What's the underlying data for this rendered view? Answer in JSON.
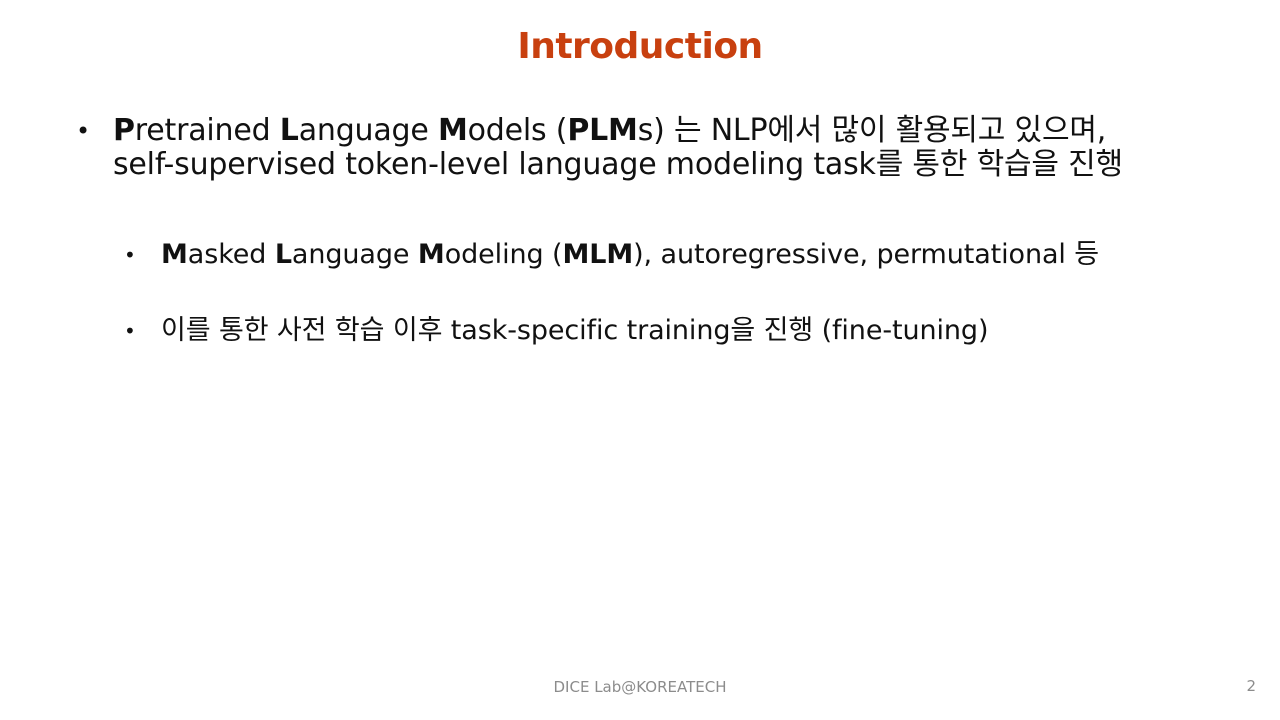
{
  "slide": {
    "title": "Introduction",
    "bullet1": {
      "segments": [
        {
          "text": "P",
          "bold": true
        },
        {
          "text": "retrained ",
          "bold": false
        },
        {
          "text": "L",
          "bold": true
        },
        {
          "text": "anguage ",
          "bold": false
        },
        {
          "text": "M",
          "bold": true
        },
        {
          "text": "odels (",
          "bold": false
        },
        {
          "text": "PLM",
          "bold": true
        },
        {
          "text": "s) 는 NLP에서 많이 활용되고 있으며,",
          "bold": false
        },
        {
          "text": "\nself-supervised token-level language modeling task를 통한 학습을 진행",
          "bold": false
        }
      ]
    },
    "bullet2": {
      "segments": [
        {
          "text": "M",
          "bold": true
        },
        {
          "text": "asked ",
          "bold": false
        },
        {
          "text": "L",
          "bold": true
        },
        {
          "text": "anguage ",
          "bold": false
        },
        {
          "text": "M",
          "bold": true
        },
        {
          "text": "odeling (",
          "bold": false
        },
        {
          "text": "MLM",
          "bold": true
        },
        {
          "text": "), autoregressive, permutational 등",
          "bold": false
        }
      ]
    },
    "bullet3": {
      "segments": [
        {
          "text": "이를 통한 사전 학습 이후 task-specific training을 진행 (fine-tuning)",
          "bold": false
        }
      ]
    },
    "bullet_glyph": "•"
  },
  "footer": {
    "text": "DICE  Lab@KOREATECH",
    "page_number": "2"
  }
}
